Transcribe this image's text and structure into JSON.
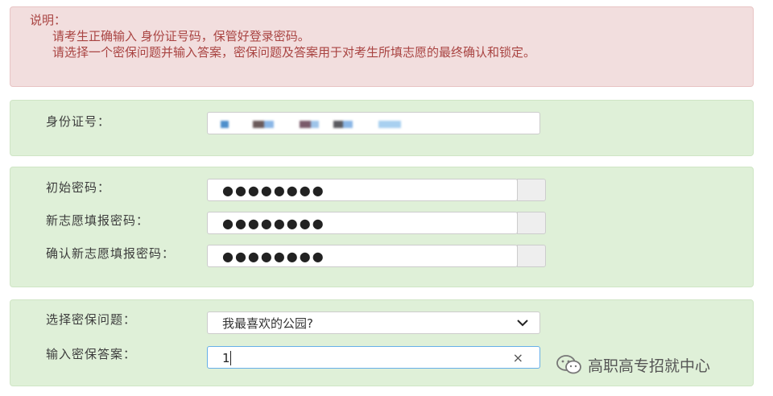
{
  "notice": {
    "heading": "说明：",
    "line1": "请考生正确输入 身份证号码，保管好登录密码。",
    "line2": "请选择一个密保问题并输入答案，密保问题及答案用于对考生所填志愿的最终确认和锁定。"
  },
  "identity": {
    "label": "身份证号："
  },
  "passwords": {
    "initial_label": "初始密码：",
    "initial_value": "●●●●●●●●",
    "new_label": "新志愿填报密码：",
    "new_value": "●●●●●●●●",
    "confirm_label": "确认新志愿填报密码：",
    "confirm_value": "●●●●●●●●"
  },
  "security": {
    "question_label": "选择密保问题：",
    "question_selected": "我最喜欢的公园?",
    "answer_label": "输入密保答案：",
    "answer_value": "1"
  },
  "icons": {
    "dropdown": "chevron-down-icon",
    "clear": "clear-icon",
    "watermark": "wechat-icon"
  },
  "watermark": {
    "text": "高职高专招就中心"
  },
  "colors": {
    "notice_bg": "#f2dede",
    "notice_text": "#a94442",
    "panel_bg": "#dff0d8"
  }
}
